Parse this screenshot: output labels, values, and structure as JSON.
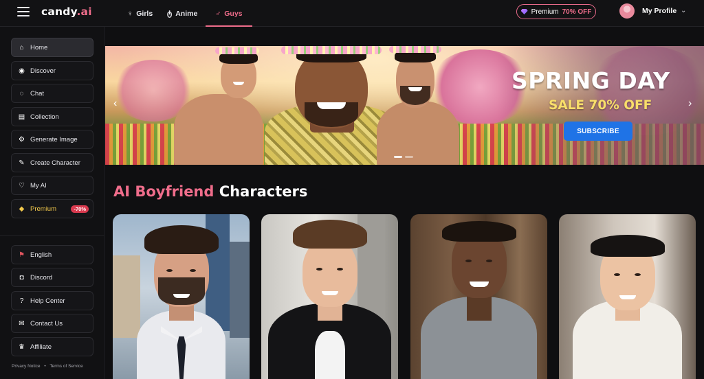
{
  "topbar": {
    "logo_main": "candy",
    "logo_suffix": ".ai",
    "tabs": [
      {
        "label": "Girls",
        "icon": "female-icon"
      },
      {
        "label": "Anime",
        "icon": "anime-icon"
      },
      {
        "label": "Guys",
        "icon": "male-icon",
        "active": true
      }
    ],
    "premium": {
      "label": "Premium",
      "offer": "70% OFF"
    },
    "profile_label": "My Profile"
  },
  "sidebar": {
    "items": [
      {
        "label": "Home",
        "icon": "home-icon",
        "active": true
      },
      {
        "label": "Discover",
        "icon": "compass-icon"
      },
      {
        "label": "Chat",
        "icon": "chat-icon"
      },
      {
        "label": "Collection",
        "icon": "collection-icon"
      },
      {
        "label": "Generate Image",
        "icon": "image-icon"
      },
      {
        "label": "Create Character",
        "icon": "create-icon"
      },
      {
        "label": "My AI",
        "icon": "heart-icon"
      },
      {
        "label": "Premium",
        "icon": "diamond-icon",
        "badge": "-70%"
      }
    ],
    "bottom_items": [
      {
        "label": "English",
        "icon": "us-flag-icon"
      },
      {
        "label": "Discord",
        "icon": "discord-icon"
      },
      {
        "label": "Help Center",
        "icon": "help-icon"
      },
      {
        "label": "Contact Us",
        "icon": "contact-icon"
      },
      {
        "label": "Affiliate",
        "icon": "trophy-icon"
      }
    ],
    "footer": {
      "privacy": "Privacy Notice",
      "separator": "•",
      "terms": "Terms of Service"
    }
  },
  "banner": {
    "title": "SPRING DAY",
    "sale": "SALE 70% OFF",
    "cta": "SUBSCRIBE"
  },
  "section": {
    "title_accent": "AI Boyfriend",
    "title_rest": "Characters"
  },
  "colors": {
    "accent": "#ef6d8b",
    "cta_blue": "#1f73e6",
    "sale_yellow": "#f8de6a",
    "badge_red": "#d93a4f"
  }
}
